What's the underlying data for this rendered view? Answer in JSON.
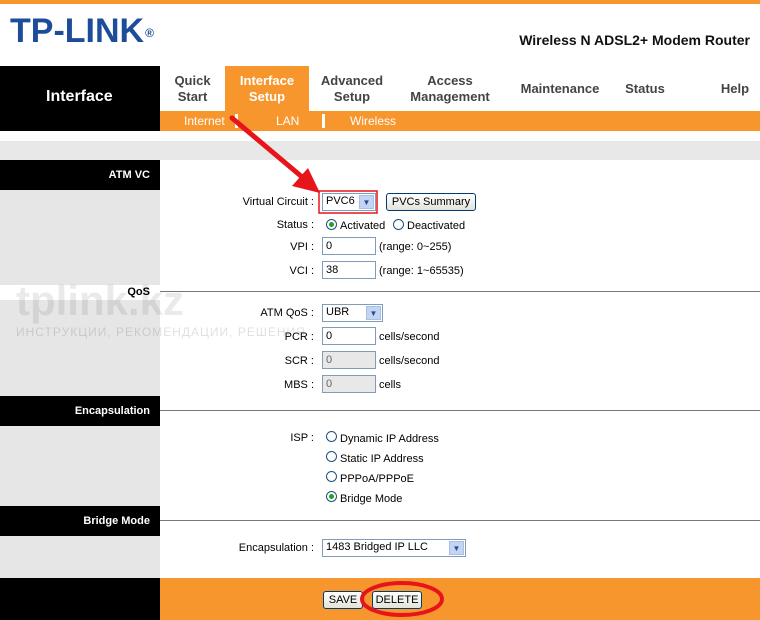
{
  "header": {
    "brand": "TP-LINK",
    "registered": "®",
    "model": "Wireless N ADSL2+ Modem Router"
  },
  "nav": {
    "section_title": "Interface",
    "items": [
      {
        "label": "Quick\nStart"
      },
      {
        "label": "Interface\nSetup",
        "active": true
      },
      {
        "label": "Advanced\nSetup"
      },
      {
        "label": "Access\nManagement"
      },
      {
        "label": "Maintenance"
      },
      {
        "label": "Status"
      },
      {
        "label": "Help"
      }
    ],
    "subitems": [
      {
        "label": "Internet",
        "active": true
      },
      {
        "label": "LAN"
      },
      {
        "label": "Wireless"
      }
    ]
  },
  "sections": {
    "atm_vc": "ATM VC",
    "qos": "QoS",
    "encapsulation": "Encapsulation",
    "bridge_mode": "Bridge Mode"
  },
  "atm": {
    "virtual_circuit_label": "Virtual Circuit :",
    "virtual_circuit_value": "PVC6",
    "pvcs_summary_button": "PVCs Summary",
    "status_label": "Status :",
    "status_activated": "Activated",
    "status_deactivated": "Deactivated",
    "status_selected": "Activated",
    "vpi_label": "VPI :",
    "vpi_value": "0",
    "vpi_range": "(range: 0~255)",
    "vci_label": "VCI :",
    "vci_value": "38",
    "vci_range": "(range: 1~65535)"
  },
  "qos": {
    "atm_qos_label": "ATM QoS :",
    "atm_qos_value": "UBR",
    "pcr_label": "PCR :",
    "pcr_value": "0",
    "pcr_unit": "cells/second",
    "scr_label": "SCR :",
    "scr_value": "0",
    "scr_unit": "cells/second",
    "mbs_label": "MBS :",
    "mbs_value": "0",
    "mbs_unit": "cells"
  },
  "encapsulation": {
    "isp_label": "ISP :",
    "options": [
      "Dynamic IP Address",
      "Static IP Address",
      "PPPoA/PPPoE",
      "Bridge Mode"
    ],
    "selected": "Bridge Mode"
  },
  "bridge": {
    "encap_label": "Encapsulation :",
    "encap_value": "1483 Bridged IP LLC"
  },
  "buttons": {
    "save": "SAVE",
    "delete": "DELETE"
  },
  "watermark": {
    "site": "tplink.kz",
    "tagline": "ИНСТРУКЦИИ, РЕКОМЕНДАЦИИ, РЕШЕНИЯ"
  },
  "colors": {
    "accent": "#f7962d",
    "brand_blue": "#1d4d9a",
    "annotation_red": "#e8141b"
  }
}
